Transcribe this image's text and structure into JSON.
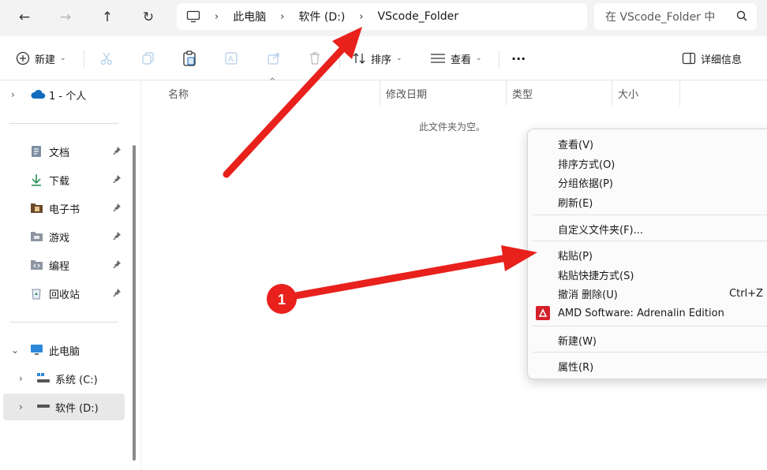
{
  "address_bar": {
    "crumbs": [
      "此电脑",
      "软件 (D:)",
      "VScode_Folder"
    ]
  },
  "search": {
    "placeholder": "在 VScode_Folder 中"
  },
  "toolbar": {
    "new_label": "新建",
    "sort_label": "排序",
    "view_label": "查看",
    "more_label": "···",
    "details_label": "详细信息"
  },
  "sidebar": {
    "onedrive_label": "1 - 个人",
    "quick_access": [
      "文档",
      "下载",
      "电子书",
      "游戏",
      "编程",
      "回收站"
    ],
    "this_pc_label": "此电脑",
    "drives": [
      "系统 (C:)",
      "软件 (D:)"
    ]
  },
  "columns": [
    "名称",
    "修改日期",
    "类型",
    "大小"
  ],
  "empty_message": "此文件夹为空。",
  "context_menu": {
    "items": [
      {
        "label": "查看(V)"
      },
      {
        "label": "排序方式(O)"
      },
      {
        "label": "分组依据(P)"
      },
      {
        "label": "刷新(E)"
      },
      {
        "label": "自定义文件夹(F)..."
      },
      {
        "label": "粘贴(P)"
      },
      {
        "label": "粘贴快捷方式(S)"
      },
      {
        "label": "撤消 删除(U)",
        "shortcut": "Ctrl+Z"
      },
      {
        "label": "AMD Software: Adrenalin Edition"
      },
      {
        "label": "新建(W)"
      },
      {
        "label": "属性(R)"
      }
    ]
  },
  "annotation": {
    "step_number": "1"
  },
  "colors": {
    "annotation_red": "#e8211d",
    "amd_red": "#d3202a",
    "onedrive_blue": "#0f6cbd",
    "folder_brown": "#6b4a2b"
  },
  "icons": [
    "back-arrow-icon",
    "forward-arrow-icon",
    "up-arrow-icon",
    "refresh-icon",
    "monitor-icon",
    "search-icon",
    "plus-circle-icon",
    "cut-icon",
    "copy-icon",
    "paste-icon",
    "rename-icon",
    "share-icon",
    "delete-icon",
    "sort-icon",
    "view-icon",
    "details-pane-icon",
    "pin-icon",
    "cloud-icon",
    "amd-icon"
  ]
}
